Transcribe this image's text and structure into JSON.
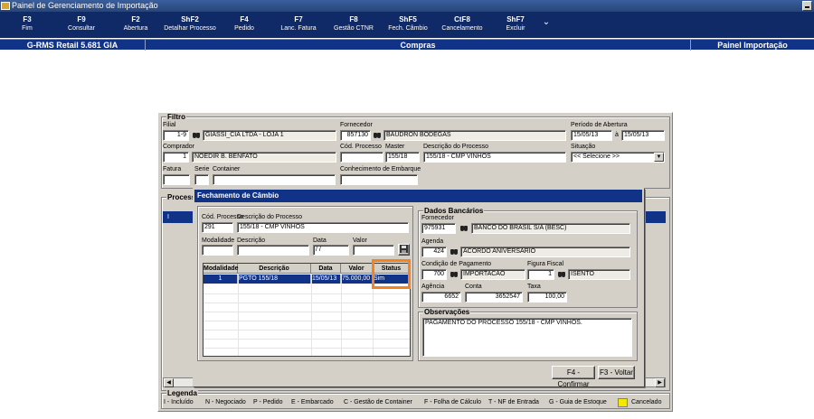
{
  "window": {
    "title": "Painel de Gerenciamento de Importação"
  },
  "toolbar": [
    {
      "key": "F3",
      "label": "Fim"
    },
    {
      "key": "F9",
      "label": "Consultar"
    },
    {
      "key": "F2",
      "label": "Abertura"
    },
    {
      "key": "ShF2",
      "label": "Detalhar Processo"
    },
    {
      "key": "F4",
      "label": "Pedido"
    },
    {
      "key": "F7",
      "label": "Lanc. Fatura"
    },
    {
      "key": "F8",
      "label": "Gestão CTNR"
    },
    {
      "key": "ShF5",
      "label": "Fech. Câmbio"
    },
    {
      "key": "CtF8",
      "label": "Cancelamento"
    },
    {
      "key": "ShF7",
      "label": "Excluir"
    }
  ],
  "toolbar_more": "⌄",
  "status": {
    "version": "G-RMS Retail 5.681 GIA",
    "module": "Compras",
    "panel": "Painel Importação"
  },
  "filtro": {
    "legend": "Filtro",
    "filial_label": "Filial",
    "filial_code": "1-9",
    "filial_name": "GIASSI_CIA LTDA - LOJA 1",
    "fornecedor_label": "Fornecedor",
    "fornecedor_code": "857130",
    "fornecedor_name": "BAUDRON BODEGAS",
    "periodo_label": "Período de Abertura",
    "periodo_de": "15/05/13",
    "periodo_sep": "à",
    "periodo_ate": "15/05/13",
    "comprador_label": "Comprador",
    "comprador_code": "1",
    "comprador_name": "NOEDIR B. BENFATO",
    "cod_processo_label": "Cód. Processo",
    "master_label": "Master",
    "master_value": "155/18",
    "desc_processo_label": "Descrição do Processo",
    "desc_processo_value": "155/18 - CMP VINHOS",
    "situacao_label": "Situação",
    "situacao_value": "<< Selecione >>",
    "fatura_label": "Fatura",
    "serie_label": "Serie",
    "container_label": "Container",
    "conhecimento_label": "Conhecimento de Embarque"
  },
  "processos": {
    "legend": "Process",
    "row_marker": "I"
  },
  "dialog": {
    "title": "Fechamento de Câmbio",
    "cod_processo_label": "Cód. Processo",
    "cod_processo_value": "291",
    "desc_processo_label": "Descrição do Processo",
    "desc_processo_value": "155/18 - CMP VINHOS",
    "modalidade_label": "Modalidade",
    "descricao_label": "Descrição",
    "data_label": "Data",
    "data_value": "/ /",
    "valor_label": "Valor",
    "grid": {
      "columns": [
        "Modalidade",
        "Descrição",
        "Data",
        "Valor",
        "Status"
      ],
      "rows": [
        [
          "1",
          "PGTO 155/18",
          "15/05/13",
          "75.000,00",
          "Sim"
        ]
      ]
    },
    "bank": {
      "legend": "Dados Bancários",
      "fornecedor_label": "Fornecedor",
      "fornecedor_value": "975931",
      "banco_value": "BANCO DO BRASIL S/A (BESC)",
      "agenda_label": "Agenda",
      "agenda_code": "424",
      "agenda_value": "ACORDO ANIVERSARIO",
      "condicao_label": "Condição de Pagamento",
      "condicao_code": "700",
      "condicao_value": "IMPORTACAO",
      "figura_label": "Figura Fiscal",
      "figura_code": "1",
      "figura_value": "ISENTO",
      "agencia_label": "Agência",
      "agencia_value": "6652",
      "conta_label": "Conta",
      "conta_value": "3652547",
      "taxa_label": "Taxa",
      "taxa_value": "100,00"
    },
    "obs": {
      "legend": "Observações",
      "text": "PAGAMENTO DO PROCESSO 155/18 - CMP VINHOS."
    },
    "confirm_label": "F4 - Confirmar",
    "back_label": "F3 - Voltar"
  },
  "legenda": {
    "title": "Legenda",
    "items": [
      "I - Incluído",
      "N - Negociado",
      "P - Pedido",
      "E - Embarcado",
      "C - Gestão de Container",
      "F - Folha de Cálculo",
      "T - NF de Entrada",
      "G - Guia de Estoque"
    ],
    "cancelado": "Cancelado",
    "cancel_color": "#f7e600"
  },
  "colors": {
    "toolbar": "#0f2a66",
    "status": "#103388",
    "highlight": "#f58220"
  }
}
